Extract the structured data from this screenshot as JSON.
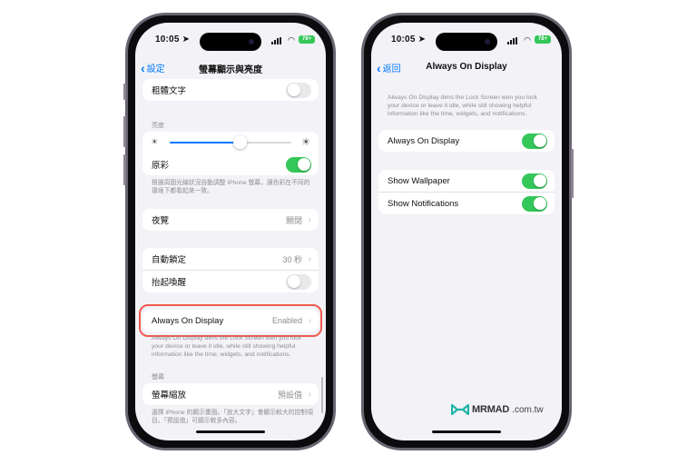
{
  "left_phone": {
    "status": {
      "time": "10:05",
      "battery": "78+"
    },
    "nav": {
      "back_label": "設定",
      "title": "螢幕顯示與亮度"
    },
    "bold_text": {
      "label": "粗體文字",
      "on": false
    },
    "brightness_section": {
      "label": "亮度",
      "brightness_level": 0.58
    },
    "true_tone": {
      "label": "原彩",
      "on": true,
      "footnote": "根據周圍光線狀況自動調整 iPhone 螢幕，讓色彩在不同的環境下都看起來一致。"
    },
    "night_shift": {
      "label": "夜覽",
      "value": "關閉"
    },
    "auto_lock": {
      "label": "自動鎖定",
      "value": "30 秒"
    },
    "raise_to_wake": {
      "label": "抬起喚醒",
      "on": false
    },
    "always_on": {
      "label": "Always On Display",
      "value": "Enabled",
      "footnote": "Always On Display dims the Lock Screen wen you lock your device or leave it idle, while still showing helpful information like the time, widgets, and notifications."
    },
    "display_section": {
      "label": "螢幕"
    },
    "display_zoom": {
      "label": "螢幕縮放",
      "value": "預設值",
      "footnote": "選擇 iPhone 的顯示畫面。「放大文字」會顯示較大的控制項目。「預設值」可顯示較多內容。"
    }
  },
  "right_phone": {
    "status": {
      "time": "10:05",
      "battery": "78+"
    },
    "nav": {
      "back_label": "返回",
      "title": "Always On Display"
    },
    "description": "Always On Display dims the Lock Screen wen you lock your device or leave it idle, while still showing helpful information like the time, widgets, and notifications.",
    "always_on": {
      "label": "Always On Display",
      "on": true
    },
    "show_wallpaper": {
      "label": "Show Wallpaper",
      "on": true
    },
    "show_notifications": {
      "label": "Show Notifications",
      "on": true
    }
  },
  "watermark": {
    "brand": "MRMAD",
    "domain": ".com.tw"
  },
  "colors": {
    "accent": "#007aff",
    "toggle_on": "#34c759",
    "highlight": "#ef5a4f",
    "logo": "#1fb5a8"
  }
}
